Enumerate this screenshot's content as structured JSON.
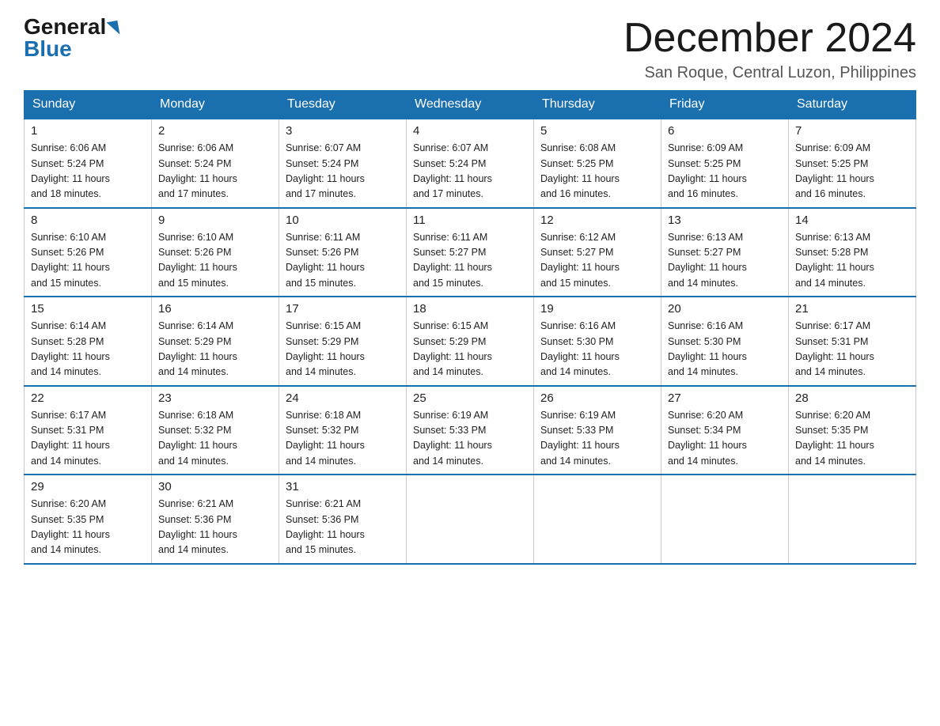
{
  "header": {
    "logo_general": "General",
    "logo_blue": "Blue",
    "month_title": "December 2024",
    "location": "San Roque, Central Luzon, Philippines"
  },
  "days_of_week": [
    "Sunday",
    "Monday",
    "Tuesday",
    "Wednesday",
    "Thursday",
    "Friday",
    "Saturday"
  ],
  "weeks": [
    [
      {
        "num": "1",
        "sunrise": "6:06 AM",
        "sunset": "5:24 PM",
        "daylight": "11 hours and 18 minutes."
      },
      {
        "num": "2",
        "sunrise": "6:06 AM",
        "sunset": "5:24 PM",
        "daylight": "11 hours and 17 minutes."
      },
      {
        "num": "3",
        "sunrise": "6:07 AM",
        "sunset": "5:24 PM",
        "daylight": "11 hours and 17 minutes."
      },
      {
        "num": "4",
        "sunrise": "6:07 AM",
        "sunset": "5:24 PM",
        "daylight": "11 hours and 17 minutes."
      },
      {
        "num": "5",
        "sunrise": "6:08 AM",
        "sunset": "5:25 PM",
        "daylight": "11 hours and 16 minutes."
      },
      {
        "num": "6",
        "sunrise": "6:09 AM",
        "sunset": "5:25 PM",
        "daylight": "11 hours and 16 minutes."
      },
      {
        "num": "7",
        "sunrise": "6:09 AM",
        "sunset": "5:25 PM",
        "daylight": "11 hours and 16 minutes."
      }
    ],
    [
      {
        "num": "8",
        "sunrise": "6:10 AM",
        "sunset": "5:26 PM",
        "daylight": "11 hours and 15 minutes."
      },
      {
        "num": "9",
        "sunrise": "6:10 AM",
        "sunset": "5:26 PM",
        "daylight": "11 hours and 15 minutes."
      },
      {
        "num": "10",
        "sunrise": "6:11 AM",
        "sunset": "5:26 PM",
        "daylight": "11 hours and 15 minutes."
      },
      {
        "num": "11",
        "sunrise": "6:11 AM",
        "sunset": "5:27 PM",
        "daylight": "11 hours and 15 minutes."
      },
      {
        "num": "12",
        "sunrise": "6:12 AM",
        "sunset": "5:27 PM",
        "daylight": "11 hours and 15 minutes."
      },
      {
        "num": "13",
        "sunrise": "6:13 AM",
        "sunset": "5:27 PM",
        "daylight": "11 hours and 14 minutes."
      },
      {
        "num": "14",
        "sunrise": "6:13 AM",
        "sunset": "5:28 PM",
        "daylight": "11 hours and 14 minutes."
      }
    ],
    [
      {
        "num": "15",
        "sunrise": "6:14 AM",
        "sunset": "5:28 PM",
        "daylight": "11 hours and 14 minutes."
      },
      {
        "num": "16",
        "sunrise": "6:14 AM",
        "sunset": "5:29 PM",
        "daylight": "11 hours and 14 minutes."
      },
      {
        "num": "17",
        "sunrise": "6:15 AM",
        "sunset": "5:29 PM",
        "daylight": "11 hours and 14 minutes."
      },
      {
        "num": "18",
        "sunrise": "6:15 AM",
        "sunset": "5:29 PM",
        "daylight": "11 hours and 14 minutes."
      },
      {
        "num": "19",
        "sunrise": "6:16 AM",
        "sunset": "5:30 PM",
        "daylight": "11 hours and 14 minutes."
      },
      {
        "num": "20",
        "sunrise": "6:16 AM",
        "sunset": "5:30 PM",
        "daylight": "11 hours and 14 minutes."
      },
      {
        "num": "21",
        "sunrise": "6:17 AM",
        "sunset": "5:31 PM",
        "daylight": "11 hours and 14 minutes."
      }
    ],
    [
      {
        "num": "22",
        "sunrise": "6:17 AM",
        "sunset": "5:31 PM",
        "daylight": "11 hours and 14 minutes."
      },
      {
        "num": "23",
        "sunrise": "6:18 AM",
        "sunset": "5:32 PM",
        "daylight": "11 hours and 14 minutes."
      },
      {
        "num": "24",
        "sunrise": "6:18 AM",
        "sunset": "5:32 PM",
        "daylight": "11 hours and 14 minutes."
      },
      {
        "num": "25",
        "sunrise": "6:19 AM",
        "sunset": "5:33 PM",
        "daylight": "11 hours and 14 minutes."
      },
      {
        "num": "26",
        "sunrise": "6:19 AM",
        "sunset": "5:33 PM",
        "daylight": "11 hours and 14 minutes."
      },
      {
        "num": "27",
        "sunrise": "6:20 AM",
        "sunset": "5:34 PM",
        "daylight": "11 hours and 14 minutes."
      },
      {
        "num": "28",
        "sunrise": "6:20 AM",
        "sunset": "5:35 PM",
        "daylight": "11 hours and 14 minutes."
      }
    ],
    [
      {
        "num": "29",
        "sunrise": "6:20 AM",
        "sunset": "5:35 PM",
        "daylight": "11 hours and 14 minutes."
      },
      {
        "num": "30",
        "sunrise": "6:21 AM",
        "sunset": "5:36 PM",
        "daylight": "11 hours and 14 minutes."
      },
      {
        "num": "31",
        "sunrise": "6:21 AM",
        "sunset": "5:36 PM",
        "daylight": "11 hours and 15 minutes."
      },
      null,
      null,
      null,
      null
    ]
  ]
}
